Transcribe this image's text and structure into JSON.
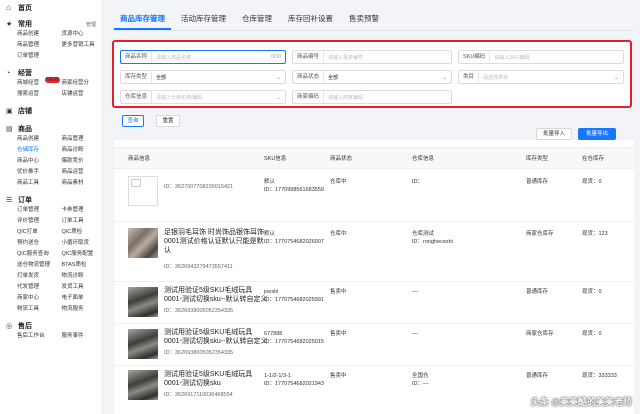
{
  "sidebar": {
    "home": "首页",
    "sections": [
      {
        "title": "常用",
        "extra": "管理",
        "items": [
          "商品创建",
          "货源中心",
          "商品管理",
          "更多营销工具",
          "订单管理"
        ]
      },
      {
        "title": "经营",
        "items": [
          "商城经营",
          "商家经营分",
          "搜索运营",
          "店铺运营"
        ],
        "badge": "NEW"
      },
      {
        "title": "店铺",
        "items": []
      },
      {
        "title": "商品",
        "items": [
          "商品创建",
          "商品管理",
          "仓储库存",
          "商品诊断",
          "商品中心",
          "爆款竞价",
          "优价推手",
          "商品运营",
          "商品工具",
          "商品素材"
        ]
      },
      {
        "title": "订单",
        "items": [
          "订单管理",
          "卡券管理",
          "评价管理",
          "订单工具",
          "QIC打单",
          "QIC质检",
          "预约送仓",
          "小循环取货",
          "QIC服务查询",
          "QIC服务配置",
          "送仓物流管理",
          "BTAS质检",
          "打单发货",
          "物流诊断",
          "代发管理",
          "发货工具",
          "商家中心",
          "电子面单",
          "物流工具",
          "物流服务"
        ]
      },
      {
        "title": "售后",
        "items": [
          "售后工作台",
          "服务事件"
        ]
      }
    ]
  },
  "tabs": [
    "商品库存管理",
    "活动库存管理",
    "仓库管理",
    "库存回补设置",
    "售卖预警"
  ],
  "filters": {
    "product_name": {
      "label": "商品名称",
      "placeholder": "请输入商品名称",
      "counter": "0/30"
    },
    "product_code": {
      "label": "商品编号",
      "placeholder": "请输入更多编号"
    },
    "sku_code": {
      "label": "SKU编码",
      "placeholder": "请输入SKU编码"
    },
    "stock_type": {
      "label": "库存类型",
      "value": "全部"
    },
    "product_status": {
      "label": "商品状态",
      "value": "全部"
    },
    "category": {
      "label": "类目",
      "placeholder": "请选择类目"
    },
    "warehouse": {
      "label": "仓库信息",
      "placeholder": "请输入仓库名称/编码"
    },
    "merchant_code": {
      "label": "商家编码",
      "placeholder": "请输入商家编码"
    }
  },
  "actions": {
    "query": "查询",
    "reset": "重置",
    "batch_import": "批量导入",
    "batch_export": "批量导出"
  },
  "table": {
    "columns": [
      "商品信息",
      "SKU信息",
      "商品状态",
      "仓库信息",
      "库存类型",
      "在仓库存"
    ],
    "rows": [
      {
        "name": "",
        "id": "ID：3627007708236015421",
        "sku_name": "默认",
        "sku_id": "ID：1770998561683559",
        "status": "仓库中",
        "wh_name": "",
        "wh_id": "ID：",
        "type": "普通库存",
        "stock": "现货：0"
      },
      {
        "name": "足银羽毛耳饰 时尚饰品银饰耳饰0001测试价格认证默认只能是默认",
        "id": "ID：3626943279473557411",
        "sku_name": "默认",
        "sku_id": "ID：1770754682026007",
        "status": "仓库中",
        "wh_name": "仓库测试",
        "wh_id": "ID：rongheceshi",
        "type": "商家仓库存",
        "stock": "现货：123"
      },
      {
        "name": "测试用验证5级SKU毛绒玩具0001-测试切换sku--默认转自定义",
        "id": "ID：3626938005052354335",
        "sku_name": "joeshi",
        "sku_id": "ID：1770754682025991",
        "status": "售卖中",
        "wh_name": "—",
        "wh_id": "",
        "type": "普通库存",
        "stock": "现货：0"
      },
      {
        "name": "测试用验证5级SKU毛绒玩具0001-测试切换sku--默认转自定义",
        "id": "ID：3626938005052354335",
        "sku_name": "677888",
        "sku_id": "ID：1770754682025015",
        "status": "售卖中",
        "wh_name": "—",
        "wh_id": "",
        "type": "商家仓库存",
        "stock": "现货：0"
      },
      {
        "name": "测试用验证5级SKU毛绒玩具0001-测试切换sku",
        "id": "ID：3626917110036468554",
        "sku_name": "1-1/2-1/3-1",
        "sku_id": "ID：1770754682021943",
        "status": "售卖中",
        "wh_name": "全国仓",
        "wh_id": "ID：—",
        "type": "普通库存",
        "stock": "现货：333333"
      }
    ]
  },
  "watermark": "头条 @美美酷的美美老师"
}
